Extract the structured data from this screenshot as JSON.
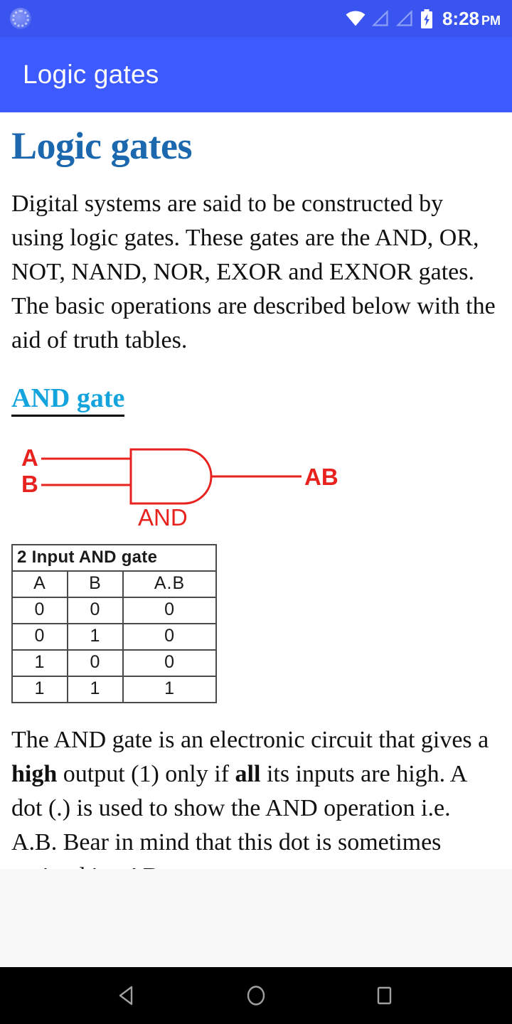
{
  "status_bar": {
    "left_icon": "sync-spinner-icon",
    "icons": [
      "wifi-icon",
      "signal-empty-icon",
      "signal-empty-icon",
      "battery-charging-icon"
    ],
    "time": "8:28",
    "meridiem": "PM",
    "background_color": "#3a55ef"
  },
  "app_bar": {
    "title": "Logic gates",
    "background_color": "#3d5afe",
    "text_color": "#ffffff"
  },
  "page": {
    "heading": "Logic gates",
    "heading_color": "#1b68ae",
    "intro_paragraph": "Digital systems are said to be constructed by using logic gates. These gates are the AND, OR, NOT, NAND, NOR, EXOR and EXNOR gates. The basic operations are described below with the aid of truth tables.",
    "section_link": "AND gate",
    "section_link_color": "#13a3dd",
    "description": {
      "part1": "The AND gate is an electronic circuit that gives a ",
      "bold1": "high",
      "part2": " output (1) only if ",
      "bold2": "all",
      "part3": " its inputs are high.  A dot (.) is used to show the AND operation i.e. A.B.  Bear in mind that this dot is sometimes omitted i.e. AB"
    }
  },
  "gate_diagram": {
    "stroke_color": "#e8231f",
    "input_a_label": "A",
    "input_b_label": "B",
    "gate_label": "AND",
    "output_label": "AB"
  },
  "truth_table": {
    "caption": "2 Input AND gate",
    "columns": [
      "A",
      "B",
      "A.B"
    ],
    "rows": [
      [
        "0",
        "0",
        "0"
      ],
      [
        "0",
        "1",
        "0"
      ],
      [
        "1",
        "0",
        "0"
      ],
      [
        "1",
        "1",
        "1"
      ]
    ]
  },
  "nav_bar": {
    "back": "back-triangle-icon",
    "home": "home-circle-icon",
    "recents": "recents-square-icon",
    "background_color": "#000000"
  }
}
